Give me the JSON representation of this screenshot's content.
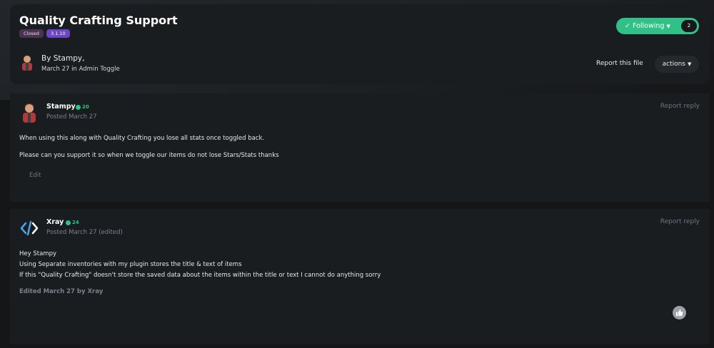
{
  "header": {
    "title": "Quality Crafting Support",
    "badges": [
      "Closed",
      "3.1.10"
    ],
    "follow_label": "Following",
    "follow_count": "2",
    "by_line": "By Stampy,",
    "date_line": "March 27 in Admin Toggle",
    "report_file": "Report this file",
    "actions_label": "actions"
  },
  "posts": [
    {
      "author": "Stampy",
      "reputation": "20",
      "date": "Posted March 27",
      "report": "Report reply",
      "lines": [
        "When using this along with Quality Crafting you lose all stats once toggled back.",
        "Please can you support it so when we toggle our items do not lose Stars/Stats thanks"
      ],
      "edit_label": "Edit"
    },
    {
      "author": "Xray",
      "reputation": "24",
      "date": "Posted March 27 (edited)",
      "report": "Report reply",
      "lines": [
        "Hey Stampy",
        "Using Separate inventories with my plugin stores the title & text of items",
        "If this \"Quality Crafting\" doesn't store the saved data about the items within the title or text I cannot do anything sorry"
      ],
      "edited_note": "Edited March 27 by Xray"
    }
  ],
  "colors": {
    "accent_green": "#2fc186",
    "badge_purple": "#6d46c8",
    "badge_closed": "#4a3350",
    "panel": "#1a1d20",
    "background": "#141618"
  },
  "icons": {
    "follow": "check-icon",
    "dropdown": "caret-down-icon",
    "reputation": "plus-circle-icon",
    "xray_avatar": "code-brackets-icon",
    "like": "thumbs-up-icon"
  }
}
